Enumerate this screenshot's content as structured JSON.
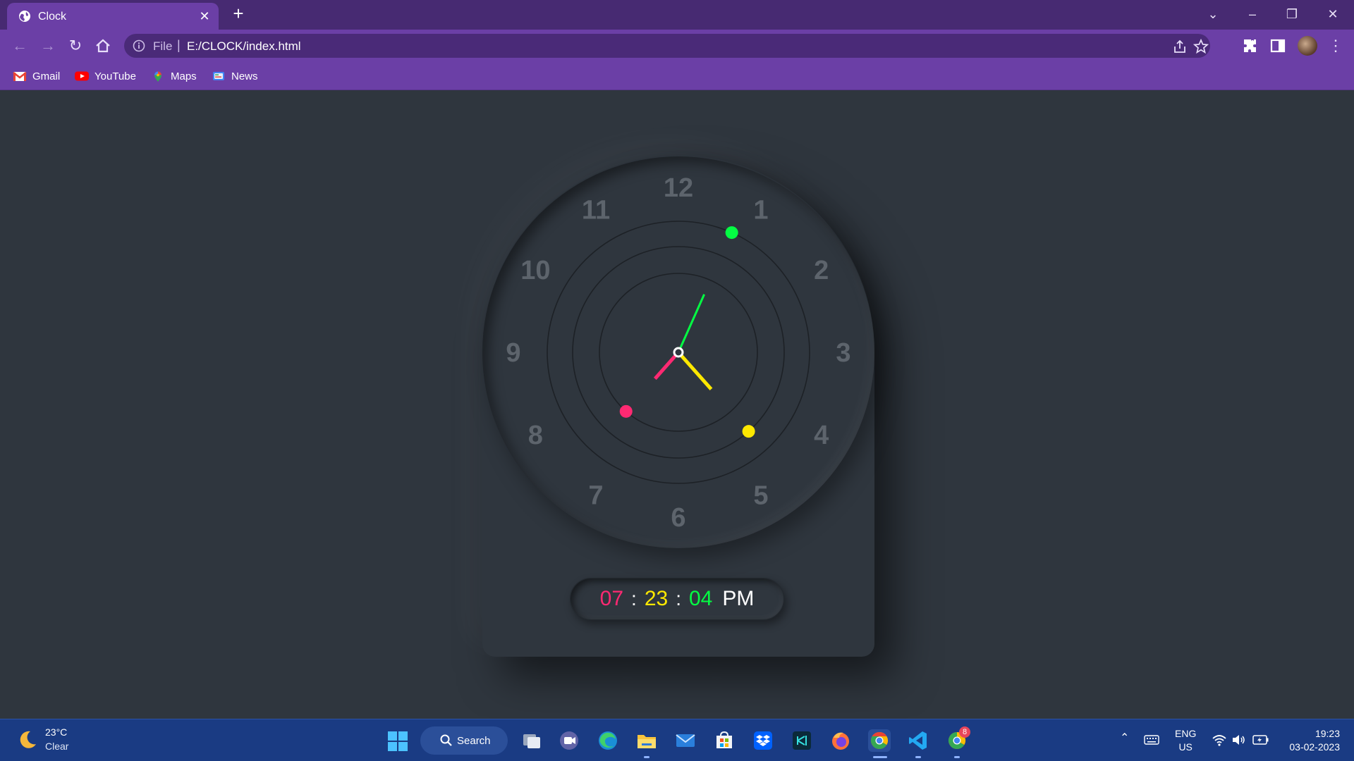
{
  "browser": {
    "tab_title": "Clock",
    "omnibox": {
      "scheme_label": "File",
      "separator": "|",
      "url": "E:/CLOCK/index.html"
    },
    "bookmarks": [
      "Gmail",
      "YouTube",
      "Maps",
      "News"
    ]
  },
  "clock": {
    "numerals": [
      "12",
      "1",
      "2",
      "3",
      "4",
      "5",
      "6",
      "7",
      "8",
      "9",
      "10",
      "11"
    ],
    "time": {
      "hours": 7,
      "minutes": 23,
      "seconds": 4
    },
    "colors": {
      "hour": "#ff2972",
      "minute": "#fee800",
      "second": "#04fc43",
      "numeral": "#5d646c",
      "ring": "#1d2126"
    },
    "digital": {
      "hours": "07",
      "sep1": ":",
      "minutes": "23",
      "sep2": ":",
      "seconds": "04",
      "ampm": "PM"
    }
  },
  "taskbar": {
    "weather": {
      "temp": "23°C",
      "condition": "Clear"
    },
    "search_label": "Search",
    "lang": {
      "line1": "ENG",
      "line2": "US"
    },
    "clock": {
      "time": "19:23",
      "date": "03-02-2023"
    },
    "notification_badge": "8"
  }
}
